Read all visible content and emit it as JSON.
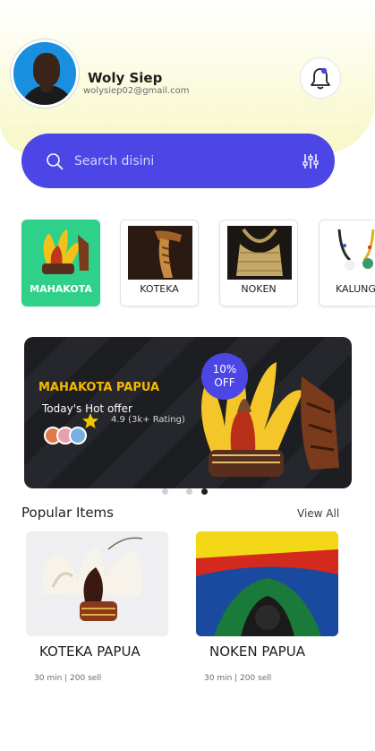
{
  "header": {
    "user_name": "Woly Siep",
    "user_email": "wolysiep02@gmail.com"
  },
  "search": {
    "placeholder": "Search disini"
  },
  "categories": [
    {
      "label": "MAHAKOTA",
      "active": true
    },
    {
      "label": "KOTEKA",
      "active": false
    },
    {
      "label": "NOKEN",
      "active": false
    },
    {
      "label": "KALUNG",
      "active": false
    }
  ],
  "promo": {
    "title": "MAHAKOTA PAPUA",
    "subtitle": "Today's Hot offer",
    "rating_text": "4.9 (3k+ Rating)",
    "discount_line1": "10%",
    "discount_line2": "OFF",
    "carousel_active_index": 2,
    "carousel_count": 3
  },
  "popular": {
    "title": "Popular Items",
    "view_all": "View All",
    "items": [
      {
        "name": "KOTEKA PAPUA",
        "meta": "30 min | 200 sell"
      },
      {
        "name": "NOKEN PAPUA",
        "meta": "30 min | 200 sell"
      }
    ]
  },
  "colors": {
    "primary": "#4c46e6",
    "active_category": "#2fd08a",
    "promo_title": "#f5b800",
    "star": "#f5c400"
  },
  "icons": [
    "bell-icon",
    "search-icon",
    "filter-icon",
    "star-icon"
  ]
}
